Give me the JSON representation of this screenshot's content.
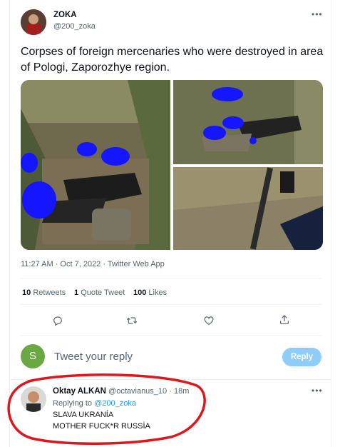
{
  "tweet": {
    "author_name": "ZOKA",
    "author_handle": "@200_zoka",
    "text": "Corpses of foreign mercenaries who were destroyed in area of Pologi, Zaporozhye region.",
    "timestamp": "11:27 AM · Oct 7, 2022 · Twitter Web App",
    "more_icon": "more-dots-icon"
  },
  "stats": {
    "retweets_count": "10",
    "retweets_label": "Retweets",
    "quote_count": "1",
    "quote_label": "Quote Tweet",
    "likes_count": "100",
    "likes_label": "Likes"
  },
  "actions": [
    "reply-icon",
    "retweet-icon",
    "like-icon",
    "share-icon"
  ],
  "composer": {
    "avatar_letter": "S",
    "avatar_color": "#6aa842",
    "placeholder": "Tweet your reply",
    "button_label": "Reply"
  },
  "reply": {
    "author_name": "Oktay ALKAN",
    "author_handle": "@octavianus_10",
    "separator": "·",
    "time": "18m",
    "replying_to_label": "Replying to",
    "replying_to_handle": "@200_zoka",
    "line1": "SLAVA UKRANÍA",
    "line2": "MOTHER FUCK*R RUSSİA"
  },
  "colors": {
    "accent": "#1d9bf0",
    "highlight_circle": "#e0161c",
    "redaction": "#1515ff"
  }
}
